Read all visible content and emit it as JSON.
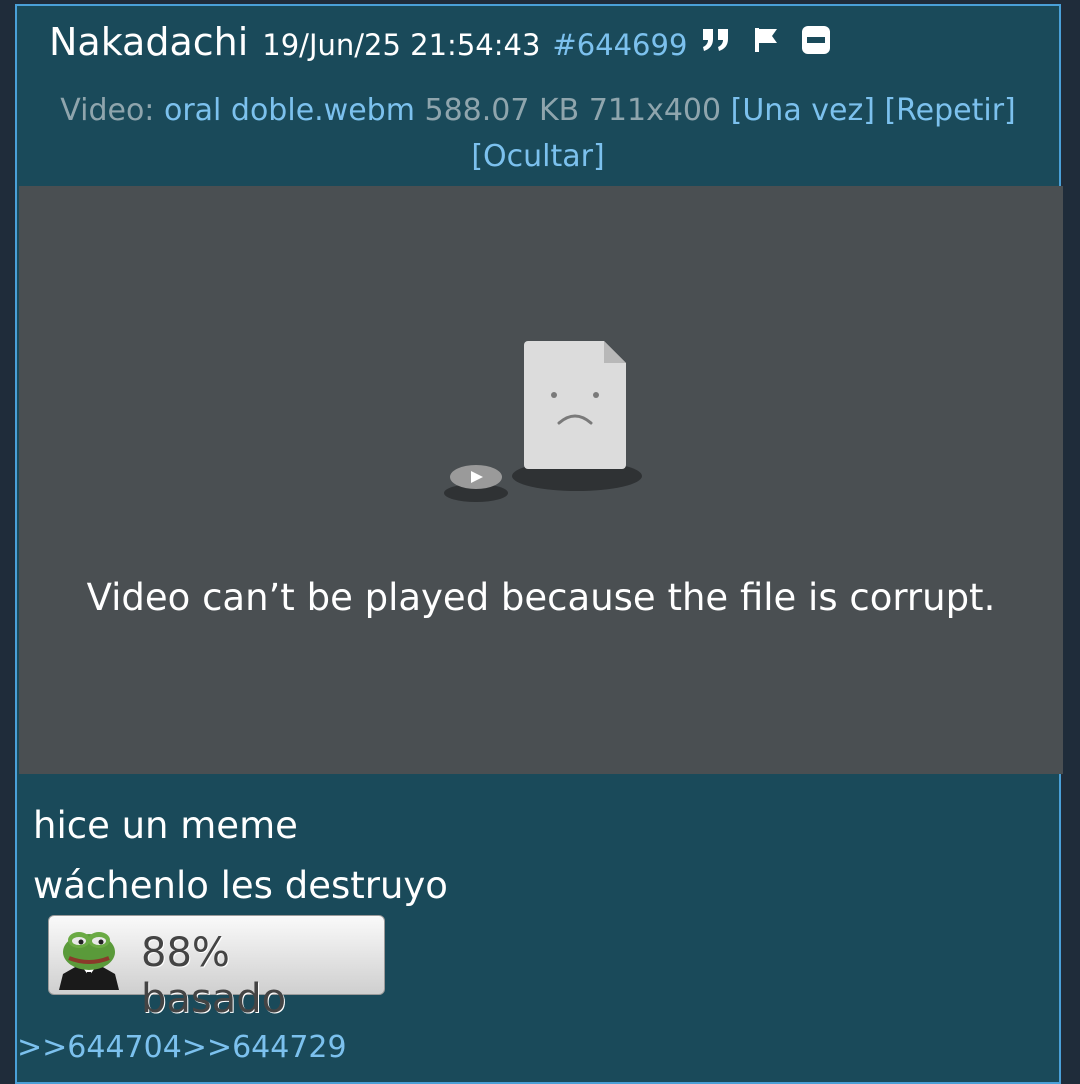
{
  "post": {
    "name": "Nakadachi",
    "date": "19/Jun/25 21:54:43",
    "number": "#644699",
    "icons": [
      "quote-icon",
      "flag-icon",
      "hide-icon"
    ]
  },
  "file": {
    "label": "Video:",
    "filename": "oral doble.webm",
    "size": "588.07 KB",
    "dimensions": "711x400",
    "once": "[Una vez]",
    "repeat": "[Repetir]",
    "hide": "[Ocultar]"
  },
  "video": {
    "error_message": "Video can’t be played because the file is corrupt."
  },
  "body": {
    "line1": "hice un meme",
    "line2": "wáchenlo les destruyo"
  },
  "badge": {
    "text": "88% basado",
    "icon": "pepe-icon"
  },
  "replies": {
    "reply1": ">>644704",
    "reply2": ">>644729"
  },
  "colors": {
    "post_bg": "#1a4a5a",
    "border": "#4aa0d8",
    "link": "#7cc1ee",
    "video_bg": "#4a4f52"
  }
}
